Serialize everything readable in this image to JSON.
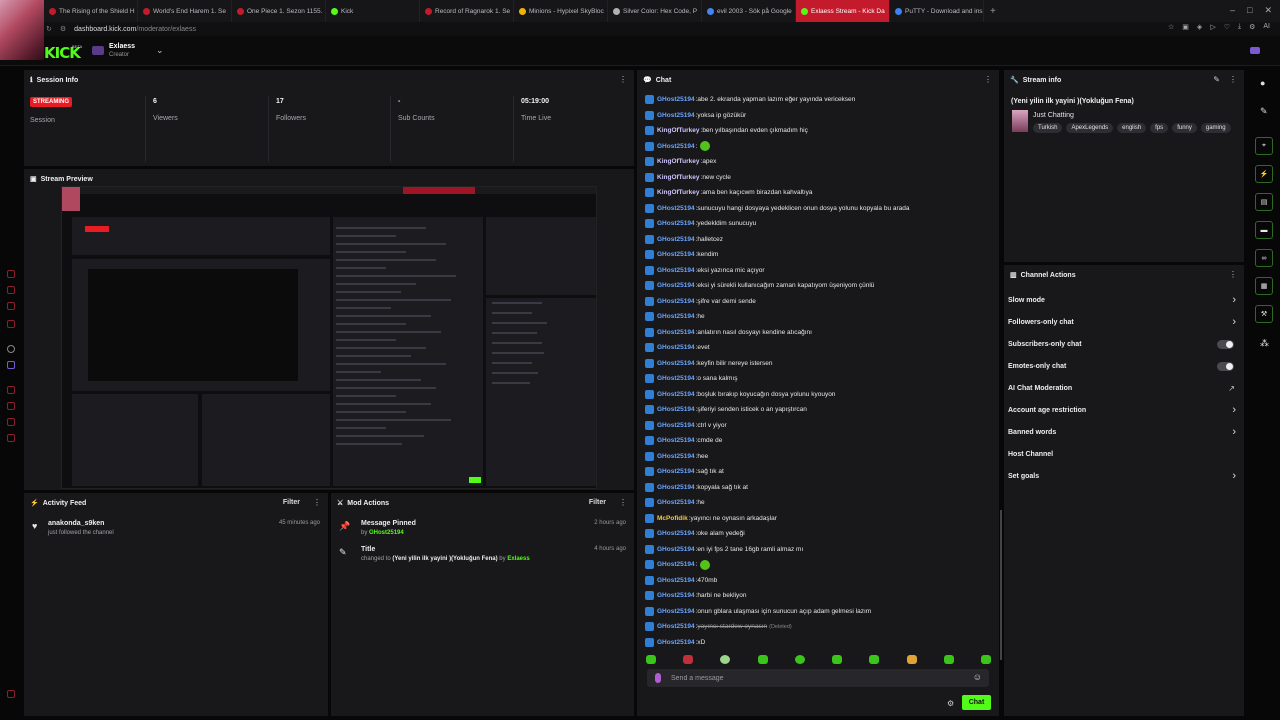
{
  "browser": {
    "tabs": [
      {
        "label": "The Rising of the Shield H",
        "color": "#c41b2c",
        "active": false
      },
      {
        "label": "World's End Harem 1. Se",
        "color": "#c41b2c",
        "active": false
      },
      {
        "label": "One Piece 1. Sezon 1155.",
        "color": "#c41b2c",
        "active": false
      },
      {
        "label": "Kick",
        "color": "#53fc18",
        "active": false
      },
      {
        "label": "Record of Ragnarok 1. Se",
        "color": "#c41b2c",
        "active": false
      },
      {
        "label": "Minions - Hypixel SkyBloc",
        "color": "#f0b400",
        "active": false
      },
      {
        "label": "Silver Color: Hex Code, P",
        "color": "#b0b0b0",
        "active": false
      },
      {
        "label": "evil 2003 - Sök på Google",
        "color": "#4285f4",
        "active": false
      },
      {
        "label": "Exlaess Stream - Kick Da",
        "color": "#53fc18",
        "active": true
      },
      {
        "label": "PuTTY - Download and ins",
        "color": "#3b82f6",
        "active": false
      }
    ],
    "new_tab": "+",
    "url_domain": "dashboard.kick.com",
    "url_path": "/moderator/exlaess",
    "ai_label": "AI"
  },
  "header": {
    "logo": "KICK",
    "beta": "BETA",
    "channel_name": "Exlaess",
    "channel_role": "Creator"
  },
  "session": {
    "title": "Session Info",
    "status_badge": "STREAMING",
    "status_label": "Session",
    "stats": [
      {
        "value": "6",
        "label": "Viewers"
      },
      {
        "value": "17",
        "label": "Followers"
      },
      {
        "value": "-",
        "label": "Sub Counts"
      },
      {
        "value": "05:19:00",
        "label": "Time Live"
      }
    ]
  },
  "preview": {
    "title": "Stream Preview"
  },
  "activity": {
    "title": "Activity Feed",
    "filter": "Filter",
    "items": [
      {
        "user": "anakonda_s9ken",
        "text": "just followed the channel",
        "time": "45 minutes ago"
      }
    ]
  },
  "mod_actions": {
    "title": "Mod Actions",
    "filter": "Filter",
    "items": [
      {
        "title": "Message Pinned",
        "by_prefix": "by",
        "by_user": "GHost25194",
        "time": "2 hours ago"
      },
      {
        "title": "Title",
        "change_prefix": "changed to",
        "change_value": "(Yeni yilin ilk yayini )(Yokluğun Fena)",
        "by_prefix": "by",
        "by_user": "Exlaess",
        "time": "4 hours ago"
      }
    ]
  },
  "chat": {
    "title": "Chat",
    "messages": [
      {
        "user": "GHost25194",
        "color": "#6aa5ff",
        "text": "abe 2. ekranda yapman lazım eğer yayında vericeksen"
      },
      {
        "user": "GHost25194",
        "color": "#6aa5ff",
        "text": "yoksa ip gözükür"
      },
      {
        "user": "KingOfTurkey",
        "color": "#d0c3ff",
        "text": "ben yılbaşından evden çıkmadım hiç"
      },
      {
        "user": "GHost25194",
        "color": "#6aa5ff",
        "text": "",
        "emote": true
      },
      {
        "user": "KingOfTurkey",
        "color": "#d0c3ff",
        "text": "apex"
      },
      {
        "user": "KingOfTurkey",
        "color": "#d0c3ff",
        "text": "new cycle"
      },
      {
        "user": "KingOfTurkey",
        "color": "#d0c3ff",
        "text": "ama ben kaçıcwm birazdan kahvaltıya"
      },
      {
        "user": "GHost25194",
        "color": "#6aa5ff",
        "text": "sunucuyu hangi dosyaya yedeklicen onun dosya yolunu kopyala bu arada"
      },
      {
        "user": "GHost25194",
        "color": "#6aa5ff",
        "text": "yedekldim sunucuyu"
      },
      {
        "user": "GHost25194",
        "color": "#6aa5ff",
        "text": "halletcez"
      },
      {
        "user": "GHost25194",
        "color": "#6aa5ff",
        "text": "kendim"
      },
      {
        "user": "GHost25194",
        "color": "#6aa5ff",
        "text": "eksi yazınca mic açıyor"
      },
      {
        "user": "GHost25194",
        "color": "#6aa5ff",
        "text": "eksi yi sürekli kullanıcağım zaman kapatıyom üşeniyom çünlü"
      },
      {
        "user": "GHost25194",
        "color": "#6aa5ff",
        "text": "şifre var demi sende"
      },
      {
        "user": "GHost25194",
        "color": "#6aa5ff",
        "text": "he"
      },
      {
        "user": "GHost25194",
        "color": "#6aa5ff",
        "text": "anlatırın nasıl dosyayı kendine atıcağını"
      },
      {
        "user": "GHost25194",
        "color": "#6aa5ff",
        "text": "evet"
      },
      {
        "user": "GHost25194",
        "color": "#6aa5ff",
        "text": "keyfin bilir nereye istersen"
      },
      {
        "user": "GHost25194",
        "color": "#6aa5ff",
        "text": "o sana kalmış"
      },
      {
        "user": "GHost25194",
        "color": "#6aa5ff",
        "text": "boşluk bırakıp koyucağın dosya yolunu kyouyon"
      },
      {
        "user": "GHost25194",
        "color": "#6aa5ff",
        "text": "şiferiyi senden isticek o an yapıştırcan"
      },
      {
        "user": "GHost25194",
        "color": "#6aa5ff",
        "text": "ctrl v yiyor"
      },
      {
        "user": "GHost25194",
        "color": "#6aa5ff",
        "text": "cmde de"
      },
      {
        "user": "GHost25194",
        "color": "#6aa5ff",
        "text": "hee"
      },
      {
        "user": "GHost25194",
        "color": "#6aa5ff",
        "text": "sağ tık at"
      },
      {
        "user": "GHost25194",
        "color": "#6aa5ff",
        "text": "kopyala sağ tık at"
      },
      {
        "user": "GHost25194",
        "color": "#6aa5ff",
        "text": "he"
      },
      {
        "user": "McPofidik",
        "color": "#f3c84b",
        "text": "yayıncı ne oynasın arkadaşlar"
      },
      {
        "user": "GHost25194",
        "color": "#6aa5ff",
        "text": "oke alam yedeği"
      },
      {
        "user": "GHost25194",
        "color": "#6aa5ff",
        "text": "en iyi fps 2 tane 16gb ramli almaz mı"
      },
      {
        "user": "GHost25194",
        "color": "#6aa5ff",
        "text": "",
        "emote": true
      },
      {
        "user": "GHost25194",
        "color": "#6aa5ff",
        "text": "470mb"
      },
      {
        "user": "GHost25194",
        "color": "#6aa5ff",
        "text": "harbi ne bekliyon"
      },
      {
        "user": "GHost25194",
        "color": "#6aa5ff",
        "text": "onun gblara ulaşması için sunucun açıp adam gelmesi lazım"
      },
      {
        "user": "GHost25194",
        "color": "#6aa5ff",
        "text": "yayıncı stardew oynasın",
        "deleted": true,
        "deleted_label": "(Deleted)"
      },
      {
        "user": "GHost25194",
        "color": "#6aa5ff",
        "text": "xD"
      }
    ],
    "input_placeholder": "Send a message",
    "send_label": "Chat"
  },
  "stream_info": {
    "title": "Stream info",
    "stream_title": "(Yeni yilin ilk yayini )(Yokluğun Fena)",
    "category": "Just Chatting",
    "tags": [
      "Turkish",
      "ApexLegends",
      "english",
      "fps",
      "funny",
      "gaming"
    ]
  },
  "channel_actions": {
    "title": "Channel Actions",
    "items": [
      {
        "label": "Slow mode",
        "control": "chevron"
      },
      {
        "label": "Followers-only chat",
        "control": "chevron"
      },
      {
        "label": "Subscribers-only chat",
        "control": "toggle"
      },
      {
        "label": "Emotes-only chat",
        "control": "toggle"
      },
      {
        "label": "AI Chat Moderation",
        "control": "external"
      },
      {
        "label": "Account age restriction",
        "control": "chevron"
      },
      {
        "label": "Banned words",
        "control": "chevron"
      },
      {
        "label": "Host Channel",
        "control": "none"
      },
      {
        "label": "Set goals",
        "control": "chevron"
      }
    ]
  }
}
